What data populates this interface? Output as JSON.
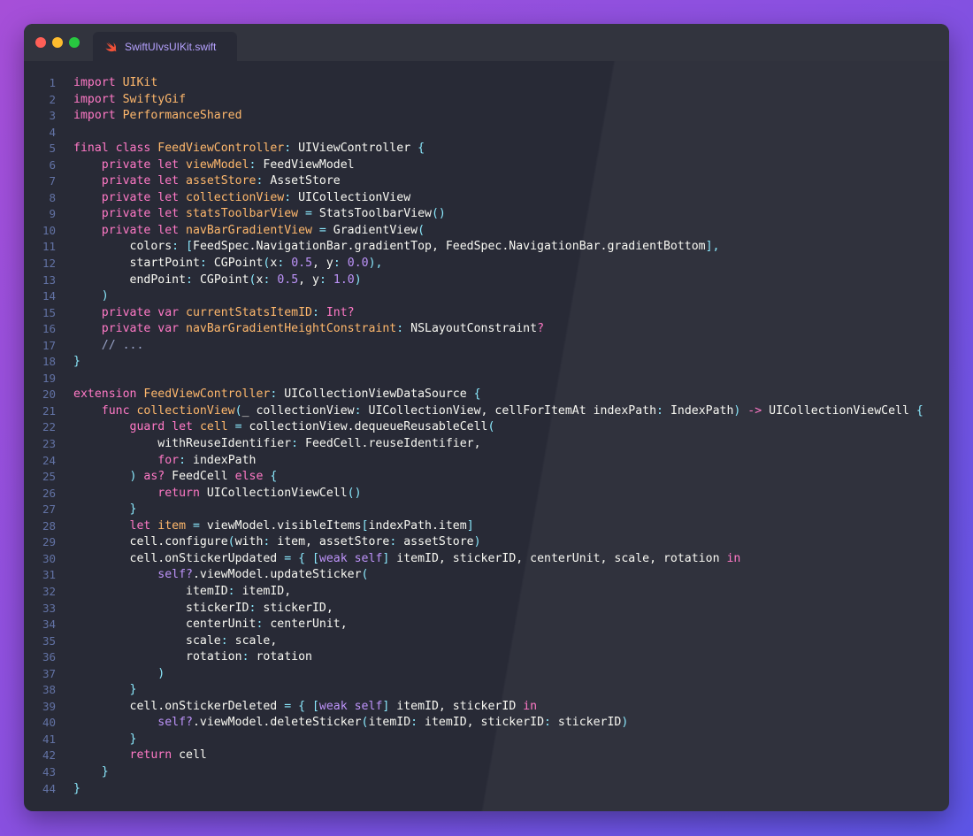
{
  "window": {
    "tab_title": "SwiftUIvsUIKit.swift",
    "tab_icon": "swift-icon"
  },
  "colors": {
    "background": "#282a36",
    "keyword": "#ff79c6",
    "type": "#ffb86c",
    "punctuation": "#8be9fd",
    "number": "#bd93f9",
    "line_number": "#6272a4"
  },
  "code_lines": [
    [
      [
        "k",
        "import"
      ],
      [
        "",
        ""
      ],
      [
        "t",
        " UIKit"
      ]
    ],
    [
      [
        "k",
        "import"
      ],
      [
        "t",
        " SwiftyGif"
      ]
    ],
    [
      [
        "k",
        "import"
      ],
      [
        "t",
        " PerformanceShared"
      ]
    ],
    [],
    [
      [
        "k",
        "final class"
      ],
      [
        "t",
        " FeedViewController"
      ],
      [
        "p",
        ":"
      ],
      [
        "",
        " UIViewController "
      ],
      [
        "p",
        "{"
      ]
    ],
    [
      [
        "",
        "    "
      ],
      [
        "k",
        "private let"
      ],
      [
        "t",
        " viewModel"
      ],
      [
        "p",
        ":"
      ],
      [
        "",
        " FeedViewModel"
      ]
    ],
    [
      [
        "",
        "    "
      ],
      [
        "k",
        "private let"
      ],
      [
        "t",
        " assetStore"
      ],
      [
        "p",
        ":"
      ],
      [
        "",
        " AssetStore"
      ]
    ],
    [
      [
        "",
        "    "
      ],
      [
        "k",
        "private let"
      ],
      [
        "t",
        " collectionView"
      ],
      [
        "p",
        ":"
      ],
      [
        "",
        " UICollectionView"
      ]
    ],
    [
      [
        "",
        "    "
      ],
      [
        "k",
        "private let"
      ],
      [
        "t",
        " statsToolbarView "
      ],
      [
        "p",
        "="
      ],
      [
        "",
        " StatsToolbarView"
      ],
      [
        "p",
        "()"
      ]
    ],
    [
      [
        "",
        "    "
      ],
      [
        "k",
        "private let"
      ],
      [
        "t",
        " navBarGradientView "
      ],
      [
        "p",
        "="
      ],
      [
        "",
        " GradientView"
      ],
      [
        "p",
        "("
      ]
    ],
    [
      [
        "",
        "        colors"
      ],
      [
        "p",
        ":"
      ],
      [
        "",
        " "
      ],
      [
        "p",
        "["
      ],
      [
        "",
        "FeedSpec.NavigationBar.gradientTop, FeedSpec.NavigationBar.gradientBottom"
      ],
      [
        "p",
        "],"
      ]
    ],
    [
      [
        "",
        "        startPoint"
      ],
      [
        "p",
        ":"
      ],
      [
        "",
        " CGPoint"
      ],
      [
        "p",
        "("
      ],
      [
        "",
        "x"
      ],
      [
        "p",
        ":"
      ],
      [
        "n",
        " 0.5"
      ],
      [
        "",
        ", y"
      ],
      [
        "p",
        ":"
      ],
      [
        "n",
        " 0.0"
      ],
      [
        "p",
        "),"
      ]
    ],
    [
      [
        "",
        "        endPoint"
      ],
      [
        "p",
        ":"
      ],
      [
        "",
        " CGPoint"
      ],
      [
        "p",
        "("
      ],
      [
        "",
        "x"
      ],
      [
        "p",
        ":"
      ],
      [
        "n",
        " 0.5"
      ],
      [
        "",
        ", y"
      ],
      [
        "p",
        ":"
      ],
      [
        "n",
        " 1.0"
      ],
      [
        "p",
        ")"
      ]
    ],
    [
      [
        "p",
        "    )"
      ]
    ],
    [
      [
        "",
        "    "
      ],
      [
        "k",
        "private var"
      ],
      [
        "t",
        " currentStatsItemID"
      ],
      [
        "p",
        ":"
      ],
      [
        "k",
        " Int?"
      ]
    ],
    [
      [
        "",
        "    "
      ],
      [
        "k",
        "private var"
      ],
      [
        "t",
        " navBarGradientHeightConstraint"
      ],
      [
        "p",
        ":"
      ],
      [
        "",
        " NSLayoutConstraint"
      ],
      [
        "k",
        "?"
      ]
    ],
    [
      [
        "c",
        "    // ..."
      ]
    ],
    [
      [
        "p",
        "}"
      ]
    ],
    [],
    [
      [
        "k",
        "extension"
      ],
      [
        "t",
        " FeedViewController"
      ],
      [
        "p",
        ":"
      ],
      [
        "",
        " UICollectionViewDataSource "
      ],
      [
        "p",
        "{"
      ]
    ],
    [
      [
        "",
        "    "
      ],
      [
        "k",
        "func"
      ],
      [
        "t",
        " collectionView"
      ],
      [
        "p",
        "("
      ],
      [
        "",
        "_ collectionView"
      ],
      [
        "p",
        ":"
      ],
      [
        "",
        " UICollectionView, cellForItemAt indexPath"
      ],
      [
        "p",
        ":"
      ],
      [
        "",
        " IndexPath"
      ],
      [
        "p",
        ")"
      ],
      [
        "k",
        " ->"
      ],
      [
        "",
        " UICollectionViewCell "
      ],
      [
        "p",
        "{"
      ]
    ],
    [
      [
        "",
        "        "
      ],
      [
        "k",
        "guard let"
      ],
      [
        "t",
        " cell "
      ],
      [
        "p",
        "="
      ],
      [
        "",
        " collectionView.dequeueReusableCell"
      ],
      [
        "p",
        "("
      ]
    ],
    [
      [
        "",
        "            withReuseIdentifier"
      ],
      [
        "p",
        ":"
      ],
      [
        "",
        " FeedCell.reuseIdentifier,"
      ]
    ],
    [
      [
        "",
        "            "
      ],
      [
        "k",
        "for"
      ],
      [
        "p",
        ":"
      ],
      [
        "",
        " indexPath"
      ]
    ],
    [
      [
        "p",
        "        )"
      ],
      [
        "k",
        " as?"
      ],
      [
        "",
        " FeedCell "
      ],
      [
        "k",
        "else"
      ],
      [
        "p",
        " {"
      ]
    ],
    [
      [
        "",
        "            "
      ],
      [
        "k",
        "return"
      ],
      [
        "",
        " UICollectionViewCell"
      ],
      [
        "p",
        "()"
      ]
    ],
    [
      [
        "p",
        "        }"
      ]
    ],
    [
      [
        "",
        "        "
      ],
      [
        "k",
        "let"
      ],
      [
        "t",
        " item "
      ],
      [
        "p",
        "="
      ],
      [
        "",
        " viewModel.visibleItems"
      ],
      [
        "p",
        "["
      ],
      [
        "",
        "indexPath.item"
      ],
      [
        "p",
        "]"
      ]
    ],
    [
      [
        "",
        "        cell.configure"
      ],
      [
        "p",
        "("
      ],
      [
        "",
        "with"
      ],
      [
        "p",
        ":"
      ],
      [
        "",
        " item, assetStore"
      ],
      [
        "p",
        ":"
      ],
      [
        "",
        " assetStore"
      ],
      [
        "p",
        ")"
      ]
    ],
    [
      [
        "",
        "        cell.onStickerUpdated "
      ],
      [
        "p",
        "= {"
      ],
      [
        "",
        " "
      ],
      [
        "p",
        "["
      ],
      [
        "v",
        "weak self"
      ],
      [
        "p",
        "]"
      ],
      [
        "",
        " itemID, stickerID, centerUnit, scale, rotation "
      ],
      [
        "k",
        "in"
      ]
    ],
    [
      [
        "",
        "            "
      ],
      [
        "v",
        "self?"
      ],
      [
        "",
        ".viewModel.updateSticker"
      ],
      [
        "p",
        "("
      ]
    ],
    [
      [
        "",
        "                itemID"
      ],
      [
        "p",
        ":"
      ],
      [
        "",
        " itemID,"
      ]
    ],
    [
      [
        "",
        "                stickerID"
      ],
      [
        "p",
        ":"
      ],
      [
        "",
        " stickerID,"
      ]
    ],
    [
      [
        "",
        "                centerUnit"
      ],
      [
        "p",
        ":"
      ],
      [
        "",
        " centerUnit,"
      ]
    ],
    [
      [
        "",
        "                scale"
      ],
      [
        "p",
        ":"
      ],
      [
        "",
        " scale,"
      ]
    ],
    [
      [
        "",
        "                rotation"
      ],
      [
        "p",
        ":"
      ],
      [
        "",
        " rotation"
      ]
    ],
    [
      [
        "p",
        "            )"
      ]
    ],
    [
      [
        "p",
        "        }"
      ]
    ],
    [
      [
        "",
        "        cell.onStickerDeleted "
      ],
      [
        "p",
        "= {"
      ],
      [
        "",
        " "
      ],
      [
        "p",
        "["
      ],
      [
        "v",
        "weak self"
      ],
      [
        "p",
        "]"
      ],
      [
        "",
        " itemID, stickerID "
      ],
      [
        "k",
        "in"
      ]
    ],
    [
      [
        "",
        "            "
      ],
      [
        "v",
        "self?"
      ],
      [
        "",
        ".viewModel.deleteSticker"
      ],
      [
        "p",
        "("
      ],
      [
        "",
        "itemID"
      ],
      [
        "p",
        ":"
      ],
      [
        "",
        " itemID, stickerID"
      ],
      [
        "p",
        ":"
      ],
      [
        "",
        " stickerID"
      ],
      [
        "p",
        ")"
      ]
    ],
    [
      [
        "p",
        "        }"
      ]
    ],
    [
      [
        "",
        "        "
      ],
      [
        "k",
        "return"
      ],
      [
        "",
        " cell"
      ]
    ],
    [
      [
        "p",
        "    }"
      ]
    ],
    [
      [
        "p",
        "}"
      ]
    ]
  ]
}
